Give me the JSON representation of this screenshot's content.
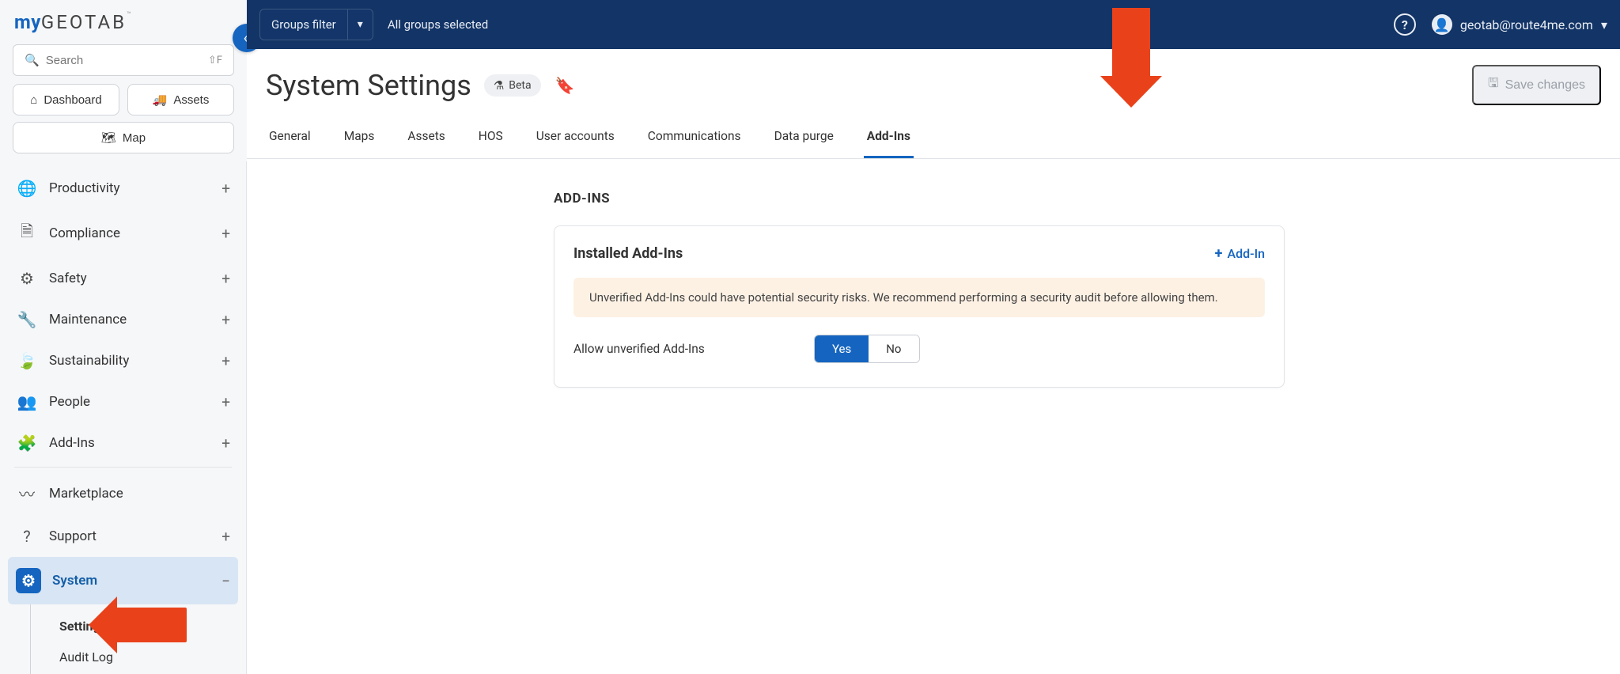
{
  "brand": {
    "part1": "my",
    "part2": "GEOTAB",
    "tm": "™"
  },
  "sidebar": {
    "search_placeholder": "Search",
    "search_shortcut": "⇧F",
    "buttons": {
      "dashboard": "Dashboard",
      "assets": "Assets",
      "map": "Map"
    },
    "items": [
      {
        "label": "Productivity",
        "icon": "globe"
      },
      {
        "label": "Compliance",
        "icon": "doc"
      },
      {
        "label": "Safety",
        "icon": "wrench-cross"
      },
      {
        "label": "Maintenance",
        "icon": "wrench"
      },
      {
        "label": "Sustainability",
        "icon": "leaf"
      },
      {
        "label": "People",
        "icon": "people"
      },
      {
        "label": "Add-Ins",
        "icon": "puzzle"
      }
    ],
    "marketplace": "Marketplace",
    "support": "Support",
    "system": {
      "label": "System",
      "children": [
        {
          "label": "Settings",
          "active": true
        },
        {
          "label": "Audit Log"
        }
      ]
    }
  },
  "topbar": {
    "groups_filter_label": "Groups filter",
    "all_groups": "All groups selected",
    "user": "geotab@route4me.com"
  },
  "page": {
    "title": "System Settings",
    "beta_label": "Beta",
    "save_label": "Save changes"
  },
  "tabs": [
    "General",
    "Maps",
    "Assets",
    "HOS",
    "User accounts",
    "Communications",
    "Data purge",
    "Add-Ins"
  ],
  "active_tab": "Add-Ins",
  "section": {
    "title": "ADD-INS",
    "card_title": "Installed Add-Ins",
    "addin_button": "Add-In",
    "warning": "Unverified Add-Ins could have potential security risks. We recommend performing a security audit before allowing them.",
    "toggle_label": "Allow unverified Add-Ins",
    "toggle_yes": "Yes",
    "toggle_no": "No",
    "toggle_value": "Yes"
  }
}
